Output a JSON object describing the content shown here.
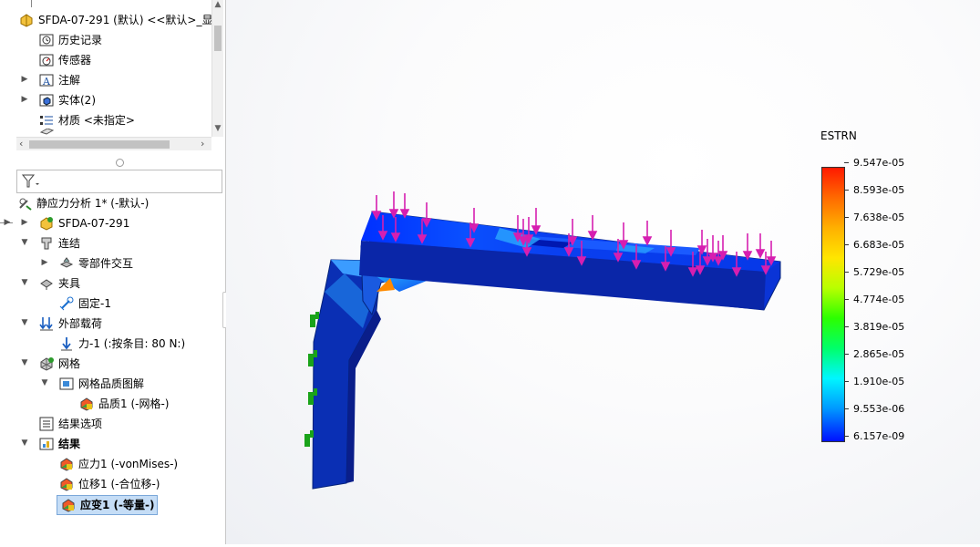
{
  "feature_tree": {
    "root_label": "SFDA-07-291 (默认) <<默认>_显示",
    "items": [
      {
        "label": "历史记录",
        "icon": "history-icon"
      },
      {
        "label": "传感器",
        "icon": "sensor-icon"
      },
      {
        "label": "注解",
        "icon": "annotation-icon"
      },
      {
        "label": "实体(2)",
        "icon": "solid-bodies-icon"
      },
      {
        "label": "材质 <未指定>",
        "icon": "material-icon"
      },
      {
        "label": "...",
        "icon": "plane-icon"
      }
    ]
  },
  "simulation_tree": {
    "study": "静应力分析 1* (-默认-)",
    "part": "SFDA-07-291",
    "connections": "连结",
    "component_interaction": "零部件交互",
    "fixtures": "夹具",
    "fixed": "固定-1",
    "external_loads": "外部载荷",
    "force": "力-1 (:按条目: 80 N:)",
    "mesh": "网格",
    "mesh_quality": "网格品质图解",
    "quality": "品质1 (-网格-)",
    "result_options": "结果选项",
    "results": "结果",
    "stress": "应力1 (-vonMises-)",
    "displacement": "位移1 (-合位移-)",
    "strain": "应变1 (-等量-)"
  },
  "legend": {
    "title": "ESTRN",
    "labels": [
      "9.547e-05",
      "8.593e-05",
      "7.638e-05",
      "6.683e-05",
      "5.729e-05",
      "4.774e-05",
      "3.819e-05",
      "2.865e-05",
      "1.910e-05",
      "9.553e-06",
      "6.157e-09"
    ]
  },
  "colors": {
    "selection": "#c5ddf6",
    "load_arrow": "#d61fb0",
    "model_blue": "#1030c8",
    "fixture_green": "#1aa31a"
  }
}
